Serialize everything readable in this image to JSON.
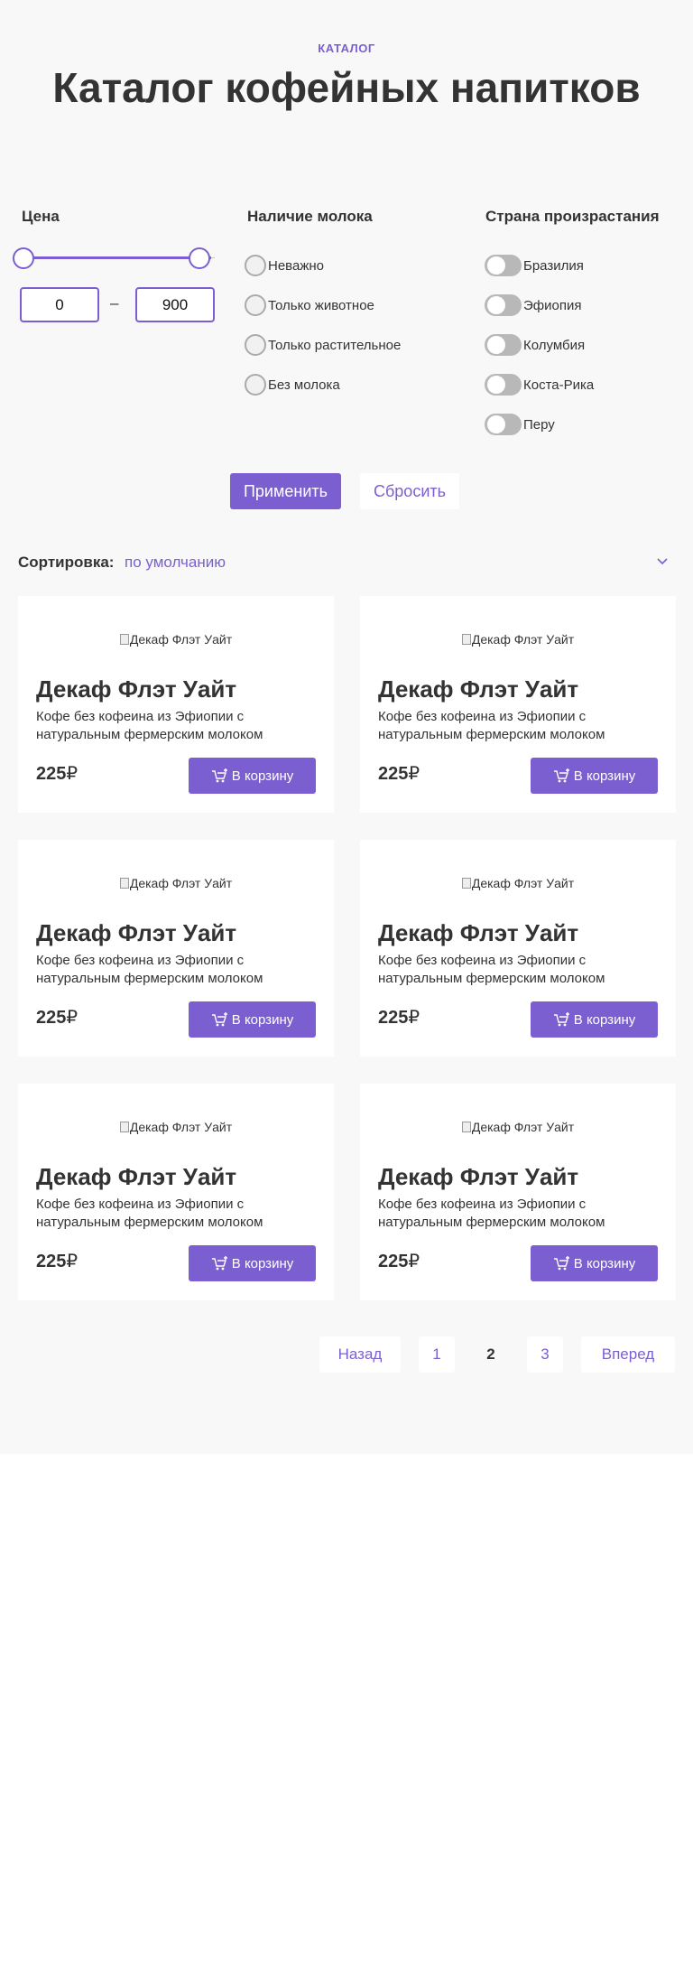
{
  "header": {
    "eyebrow": "КАТАЛОГ",
    "title": "Каталог кофейных напитков"
  },
  "filters": {
    "price": {
      "title": "Цена",
      "min": "0",
      "max": "900",
      "separator": "–"
    },
    "milk": {
      "title": "Наличие молока",
      "options": [
        "Неважно",
        "Только животное",
        "Только растительное",
        "Без молока"
      ]
    },
    "country": {
      "title": "Страна произрастания",
      "options": [
        "Бразилия",
        "Эфиопия",
        "Колумбия",
        "Коста-Рика",
        "Перу"
      ]
    },
    "apply_label": "Применить",
    "reset_label": "Сбросить"
  },
  "sort": {
    "label": "Сортировка:",
    "value": "по умолчанию"
  },
  "products": [
    {
      "image_alt": "Декаф Флэт Уайт",
      "name": "Декаф Флэт Уайт",
      "description": "Кофе без кофеина из Эфиопии с натуральным фермерским молоком",
      "price": "225",
      "currency": "₽",
      "cart_label": "В корзину"
    },
    {
      "image_alt": "Декаф Флэт Уайт",
      "name": "Декаф Флэт Уайт",
      "description": "Кофе без кофеина из Эфиопии с натуральным фермерским молоком",
      "price": "225",
      "currency": "₽",
      "cart_label": "В корзину"
    },
    {
      "image_alt": "Декаф Флэт Уайт",
      "name": "Декаф Флэт Уайт",
      "description": "Кофе без кофеина из Эфиопии с натуральным фермерским молоком",
      "price": "225",
      "currency": "₽",
      "cart_label": "В корзину"
    },
    {
      "image_alt": "Декаф Флэт Уайт",
      "name": "Декаф Флэт Уайт",
      "description": "Кофе без кофеина из Эфиопии с натуральным фермерским молоком",
      "price": "225",
      "currency": "₽",
      "cart_label": "В корзину"
    },
    {
      "image_alt": "Декаф Флэт Уайт",
      "name": "Декаф Флэт Уайт",
      "description": "Кофе без кофеина из Эфиопии с натуральным фермерским молоком",
      "price": "225",
      "currency": "₽",
      "cart_label": "В корзину"
    },
    {
      "image_alt": "Декаф Флэт Уайт",
      "name": "Декаф Флэт Уайт",
      "description": "Кофе без кофеина из Эфиопии с натуральным фермерским молоком",
      "price": "225",
      "currency": "₽",
      "cart_label": "В корзину"
    }
  ],
  "pagination": {
    "prev_label": "Назад",
    "pages": [
      "1",
      "2",
      "3"
    ],
    "current_page": "2",
    "next_label": "Вперед"
  },
  "colors": {
    "accent": "#7b5fd1",
    "background": "#f8f8f8",
    "text": "#333333"
  }
}
